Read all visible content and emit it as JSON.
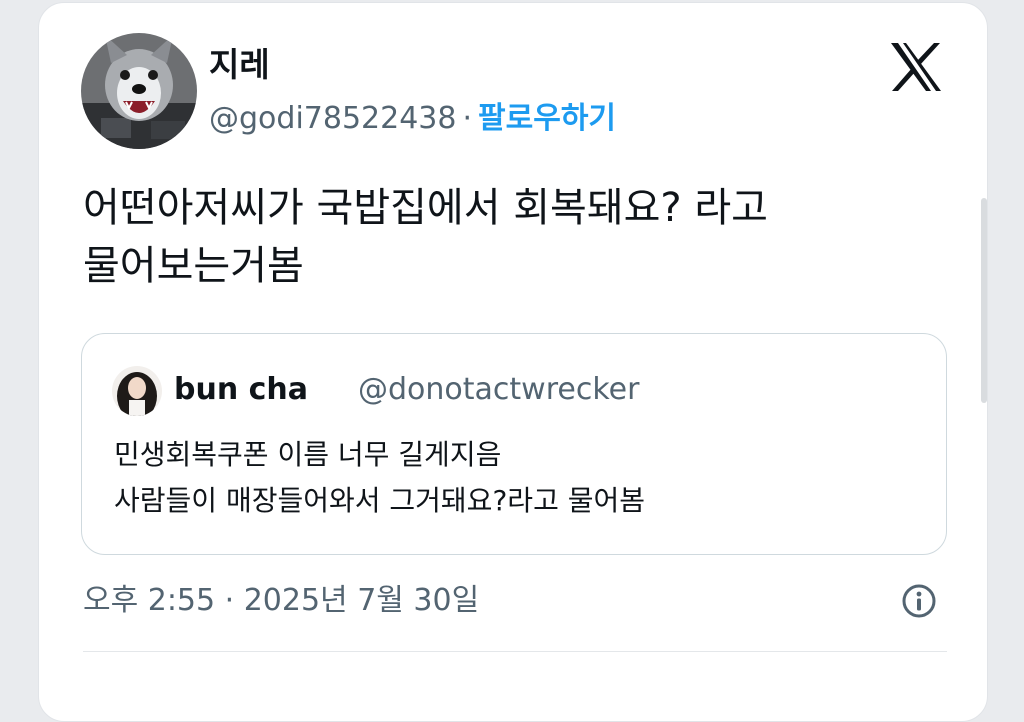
{
  "tweet": {
    "author": {
      "display_name": "지레",
      "handle": "@godi78522438",
      "separator": "·",
      "follow_label": "팔로우하기"
    },
    "brand_icon": "x-logo-icon",
    "text_lines": [
      "어떤아저씨가 국밥집에서 회복돼요? 라고",
      "물어보는거봄"
    ],
    "quoted": {
      "display_name": "bun cha",
      "handle": "@donotactwrecker",
      "text_lines": [
        "민생회복쿠폰 이름 너무 길게지음",
        "사람들이 매장들어와서 그거돼요?라고 물어봄"
      ]
    },
    "timestamp": "오후 2:55 · 2025년 7월 30일",
    "info_icon": "info-icon"
  },
  "colors": {
    "accent": "#1d9bf0",
    "text_primary": "#0f1419",
    "text_secondary": "#536471",
    "border": "#cfd9de"
  }
}
